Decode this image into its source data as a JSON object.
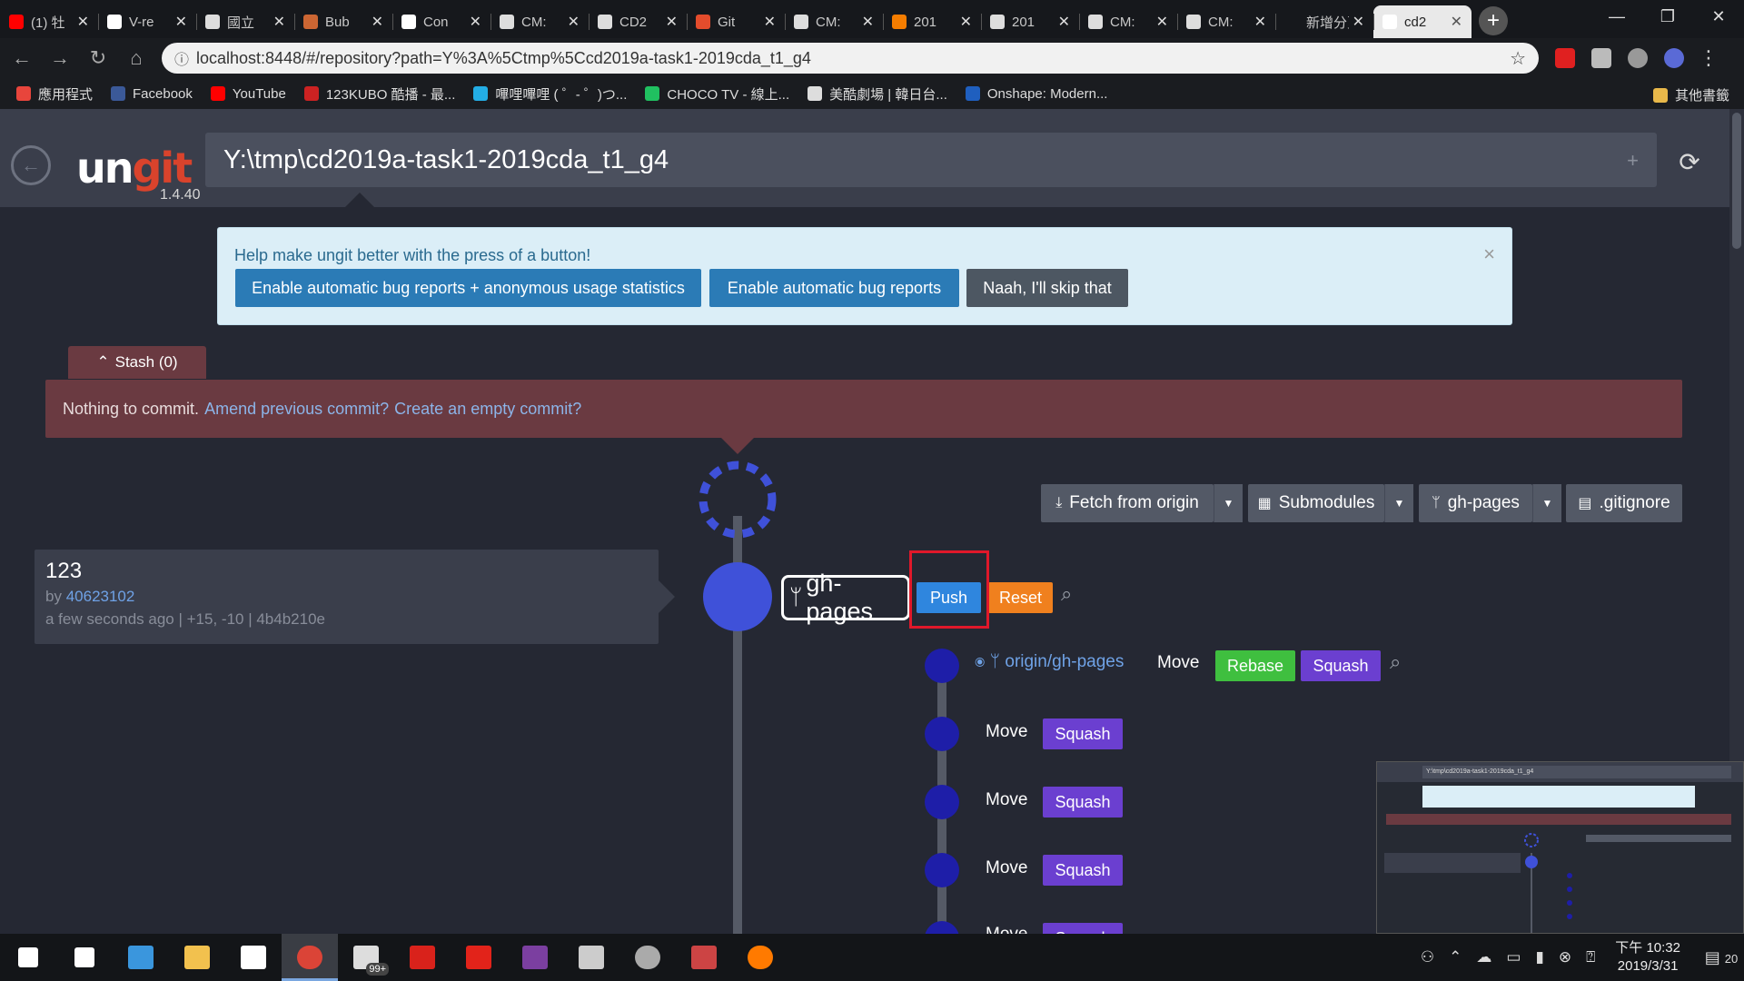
{
  "browser": {
    "tabs": [
      {
        "icon": "youtube-icon",
        "title": "(1) 牡",
        "color": "#ff0000"
      },
      {
        "icon": "github-icon",
        "title": "V-re",
        "color": "#ffffff"
      },
      {
        "icon": "cat-icon",
        "title": "國立",
        "color": "#dddddd"
      },
      {
        "icon": "runner-icon",
        "title": "Bub",
        "color": "#cc6633"
      },
      {
        "icon": "github-icon",
        "title": "Con",
        "color": "#ffffff"
      },
      {
        "icon": "page-icon",
        "title": "CM:",
        "color": "#dddddd"
      },
      {
        "icon": "cat-icon",
        "title": "CD2",
        "color": "#dddddd"
      },
      {
        "icon": "git-icon",
        "title": "Git",
        "color": "#e44c2c"
      },
      {
        "icon": "page-icon",
        "title": "CM:",
        "color": "#dddddd"
      },
      {
        "icon": "blogger-icon",
        "title": "201",
        "color": "#f57d00"
      },
      {
        "icon": "page-icon",
        "title": "201",
        "color": "#dddddd"
      },
      {
        "icon": "page-icon",
        "title": "CM:",
        "color": "#dddddd"
      },
      {
        "icon": "page-icon",
        "title": "CM:",
        "color": "#dddddd"
      },
      {
        "icon": "none",
        "title": "新增分頁",
        "color": "#dddddd"
      },
      {
        "icon": "ungit-icon",
        "title": "cd2",
        "color": "#ffffff"
      }
    ],
    "close_glyph": "✕",
    "newtab_glyph": "+",
    "window_controls": {
      "minimize": "—",
      "maximize": "❐",
      "close": "✕"
    },
    "url": "localhost:8448/#/repository?path=Y%3A%5Ctmp%5Ccd2019a-task1-2019cda_t1_g4",
    "nav": {
      "back": "←",
      "forward": "→",
      "reload": "↻",
      "home": "⌂",
      "info": "ⓘ",
      "star": "☆",
      "menu": "⋮"
    },
    "bookmarks": [
      {
        "icon": "apps-icon",
        "label": "應用程式",
        "color": "#e8453c"
      },
      {
        "icon": "facebook-icon",
        "label": "Facebook",
        "color": "#3b5998"
      },
      {
        "icon": "youtube-icon",
        "label": "YouTube",
        "color": "#ff0000"
      },
      {
        "icon": "kubo-icon",
        "label": "123KUBO 酷播 - 最...",
        "color": "#cc2222"
      },
      {
        "icon": "bilibili-icon",
        "label": "嗶哩嗶哩 ( ゜- ゜)つ...",
        "color": "#23ade5"
      },
      {
        "icon": "choco-icon",
        "label": "CHOCO TV - 線上...",
        "color": "#20c060"
      },
      {
        "icon": "page-icon",
        "label": "美酷劇場 | 韓日台...",
        "color": "#dddddd"
      },
      {
        "icon": "onshape-icon",
        "label": "Onshape: Modern...",
        "color": "#1f5fbf"
      }
    ],
    "other_bookmarks": "其他書籤"
  },
  "app": {
    "logo_un": "un",
    "logo_git": "git",
    "version": "1.4.40",
    "repo_path": "Y:\\tmp\\cd2019a-task1-2019cda_t1_g4",
    "path_plus": "+",
    "refresh": "⟳",
    "back": "←"
  },
  "banner": {
    "text": "Help make ungit better with the press of a button!",
    "btn_stats": "Enable automatic bug reports + anonymous usage statistics",
    "btn_bugs": "Enable automatic bug reports",
    "btn_skip": "Naah, I'll skip that",
    "close": "×",
    "colors": {
      "primary": "#2b7bb6",
      "secondary": "#4d5762"
    }
  },
  "stash": {
    "label": "Stash (0)",
    "icon": "chevron-up-icon",
    "glyph": "⌃"
  },
  "commit_bar": {
    "text": "Nothing to commit.",
    "amend": "Amend previous commit?",
    "empty": "Create an empty commit?"
  },
  "toolbar": {
    "fetch": "Fetch from origin",
    "submodules": "Submodules",
    "branch": "gh-pages",
    "gitignore": ".gitignore",
    "caret": "▼",
    "icons": {
      "fetch": "⤓",
      "submodules": "▦",
      "branch": "ᛘ",
      "gitignore": "▤"
    }
  },
  "commit": {
    "title": "123",
    "by": "by",
    "author": "40623102",
    "meta": "a few seconds ago | +15, -10 | 4b4b210e"
  },
  "graph": {
    "head_color": "#3f51d9",
    "node_color": "#1e1ea8",
    "line_color": "#555a66",
    "branch_label": "gh-pages",
    "branch_icon": "ᛘ",
    "push": "Push",
    "reset": "Reset",
    "remote_label": "origin/gh-pages",
    "remote_icons": "⦿ ᛘ",
    "move": "Move",
    "rebase": "Rebase",
    "squash": "Squash",
    "search": "⌕",
    "colors": {
      "push": "#2f86de",
      "reset": "#f0801e",
      "rebase": "#3fbf3f",
      "squash": "#6b3fd0"
    }
  },
  "minimap": {
    "path": "Y:\\tmp\\cd2019a-task1-2019cda_t1_g4"
  },
  "taskbar": {
    "apps": [
      {
        "name": "windows-icon",
        "color": "#ffffff"
      },
      {
        "name": "search-icon",
        "color": "#ffffff"
      },
      {
        "name": "edge-icon",
        "color": "#3a96dd"
      },
      {
        "name": "explorer-icon",
        "color": "#f2c14e"
      },
      {
        "name": "store-icon",
        "color": "#ffffff"
      },
      {
        "name": "chrome-icon",
        "color": "#db4437"
      },
      {
        "name": "mail-icon",
        "color": "#dddddd"
      },
      {
        "name": "acrobat-icon",
        "color": "#d9221b"
      },
      {
        "name": "garena-icon",
        "color": "#e2231a"
      },
      {
        "name": "winrar-icon",
        "color": "#7b3fa0"
      },
      {
        "name": "terminal-icon",
        "color": "#cccccc"
      },
      {
        "name": "globe-icon",
        "color": "#aaaaaa"
      },
      {
        "name": "app-icon",
        "color": "#cc4444"
      },
      {
        "name": "browser-icon",
        "color": "#ff7a00"
      }
    ],
    "mail_badge": "99+",
    "time": "下午 10:32",
    "date": "2019/3/31",
    "notifications": "20"
  }
}
